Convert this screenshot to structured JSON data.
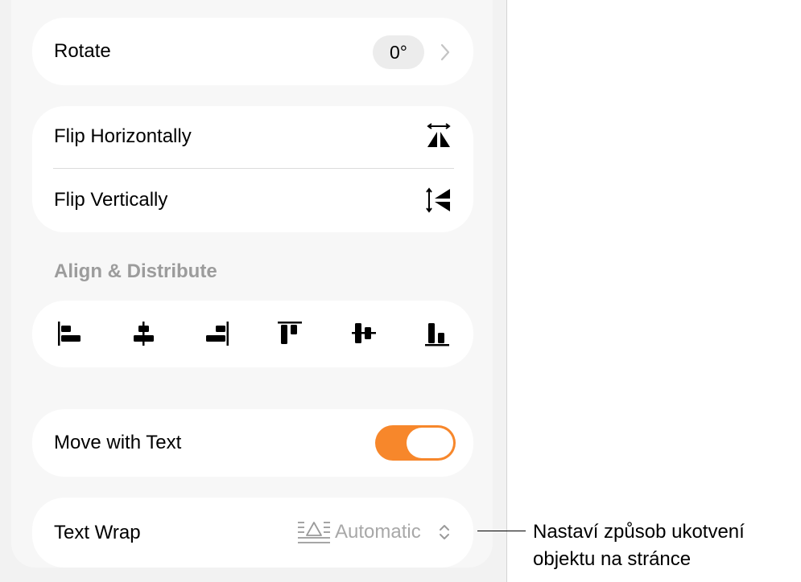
{
  "rotate": {
    "label": "Rotate",
    "value": "0°"
  },
  "flip": {
    "horizontal_label": "Flip Horizontally",
    "vertical_label": "Flip Vertically"
  },
  "align_section": {
    "header": "Align & Distribute",
    "buttons": [
      "align-left-icon",
      "align-center-icon",
      "align-right-icon",
      "align-top-icon",
      "align-middle-icon",
      "align-bottom-icon"
    ]
  },
  "move_with_text": {
    "label": "Move with Text",
    "enabled": true
  },
  "text_wrap": {
    "label": "Text Wrap",
    "value": "Automatic"
  },
  "callout": {
    "line1": "Nastaví způsob ukotvení",
    "line2": "objektu na stránce"
  },
  "colors": {
    "accent": "#f7872b",
    "panel": "#f2f2f2",
    "card": "#ffffff",
    "secondary_text": "#9c9c9c"
  }
}
